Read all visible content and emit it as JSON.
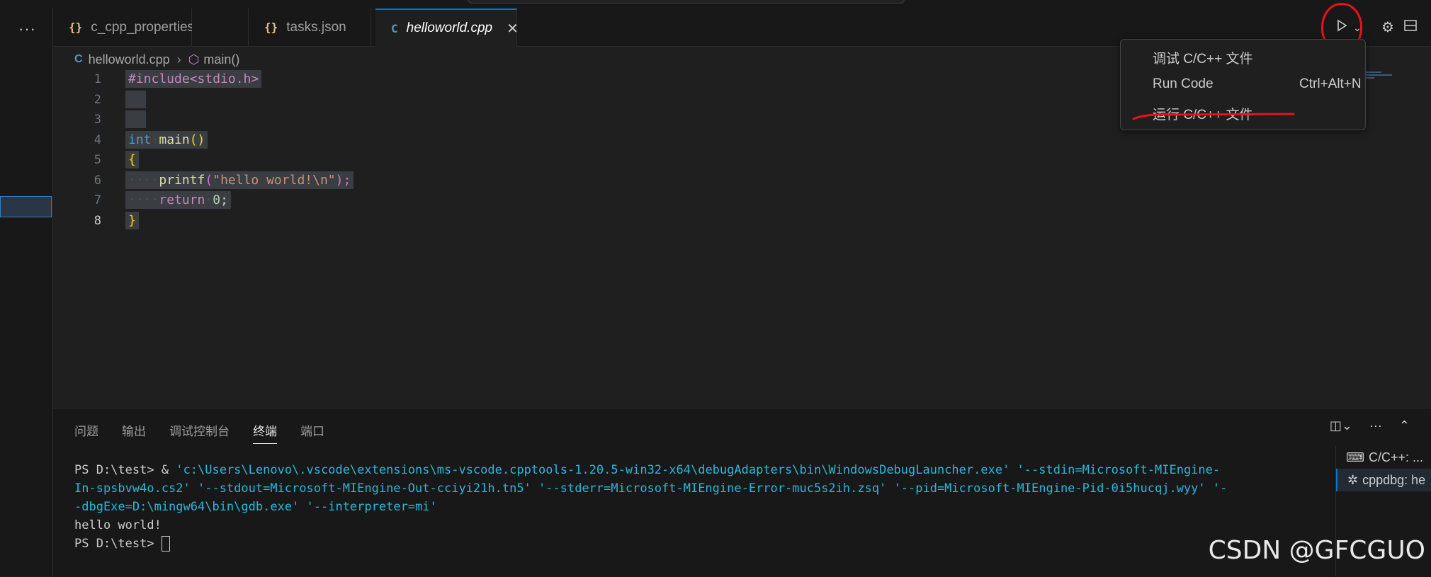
{
  "tabs": [
    {
      "icon": "{}",
      "label": "c_cpp_properties.json"
    },
    {
      "icon": "{}",
      "label": "tasks.json"
    },
    {
      "icon": "C",
      "label": "helloworld.cpp"
    }
  ],
  "tab_close": "✕",
  "breadcrumb": {
    "file": "helloworld.cpp",
    "symbol": "main()"
  },
  "line_numbers": [
    "1",
    "2",
    "3",
    "4",
    "5",
    "6",
    "7",
    "8"
  ],
  "code": {
    "l1": "#include<stdio.h>",
    "l4_type": "int",
    "l4_fn": "main",
    "l4_paren": "()",
    "l5": "{",
    "l6_fn": "printf",
    "l6_open": "(",
    "l6_str": "\"hello world!\\n\"",
    "l6_close": ");",
    "l7_kw": "return",
    "l7_num": "0",
    "l7_end": ";",
    "l8": "}"
  },
  "run_menu": {
    "item1": "调试 C/C++ 文件",
    "item2": "Run Code",
    "item2_shortcut": "Ctrl+Alt+N",
    "item3": "运行 C/C++ 文件"
  },
  "panel_tabs": [
    "问题",
    "输出",
    "调试控制台",
    "终端",
    "端口"
  ],
  "terminal": {
    "prompt1": "PS D:\\test>  & ",
    "cmd_line1": "'c:\\Users\\Lenovo\\.vscode\\extensions\\ms-vscode.cpptools-1.20.5-win32-x64\\debugAdapters\\bin\\WindowsDebugLauncher.exe' '--stdin=Microsoft-MIEngine-",
    "cmd_line2": "In-spsbvw4o.cs2' '--stdout=Microsoft-MIEngine-Out-cciyi21h.tn5' '--stderr=Microsoft-MIEngine-Error-muc5s2ih.zsq' '--pid=Microsoft-MIEngine-Pid-0i5hucqj.wyy' '-",
    "cmd_line3": "-dbgExe=D:\\mingw64\\bin\\gdb.exe' '--interpreter=mi'",
    "output": "hello world!",
    "prompt2": "PS D:\\test> "
  },
  "terminal_list": [
    "C/C++: ...",
    "cppdbg: he"
  ],
  "watermark": "CSDN @GFCGUO",
  "colors": {
    "accent": "#0078d4",
    "annotation_red": "#e8121a"
  }
}
